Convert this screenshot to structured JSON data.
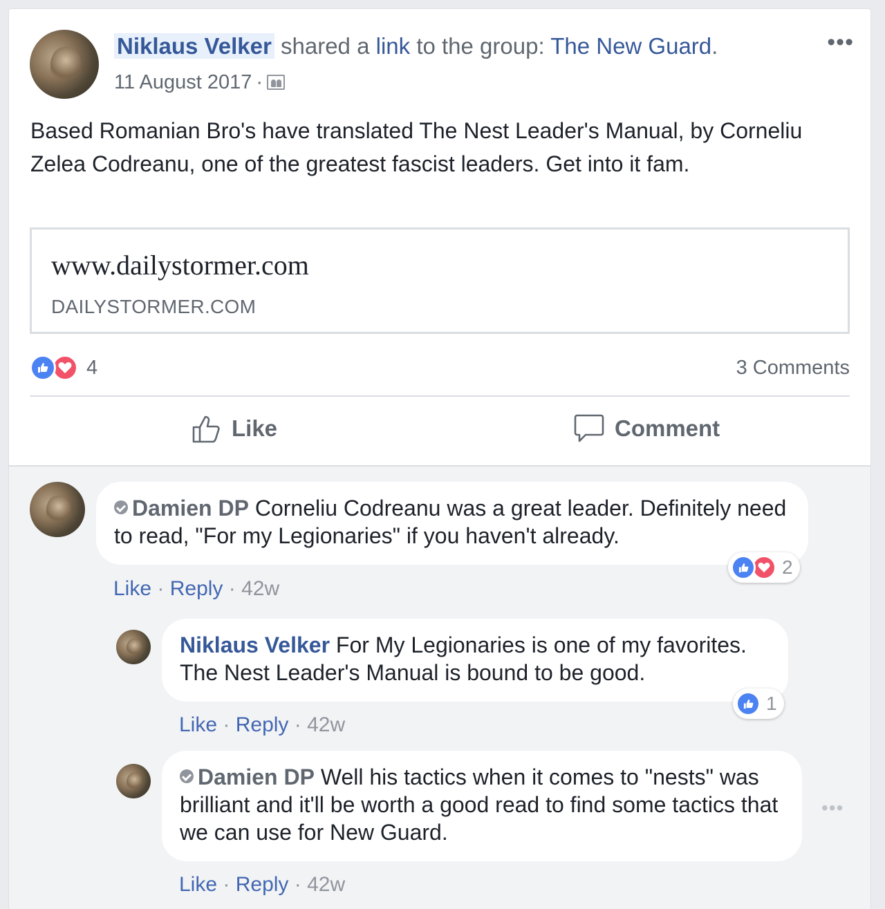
{
  "post": {
    "author": "Niklaus Velker",
    "shared_text": "shared a",
    "link_word": "link",
    "to_group_text": "to the group:",
    "group_name": "The New Guard",
    "period": ".",
    "date": "11 August 2017",
    "date_separator": "·",
    "more_icon": "•••",
    "body": "Based Romanian Bro's have translated The Nest Leader's Manual, by Corneliu Zelea Codreanu, one of the greatest fascist leaders. Get into it fam.",
    "link_preview": {
      "title": "www.dailystormer.com",
      "domain": "DAILYSTORMER.COM"
    },
    "reaction_count": "4",
    "comments_count": "3 Comments",
    "actions": {
      "like": "Like",
      "comment": "Comment"
    }
  },
  "comments": [
    {
      "author": "Damien DP",
      "verified_badge": true,
      "text": "Corneliu Codreanu was a great leader. Definitely need to read, \"For my Legionaries\" if you haven't already.",
      "like_label": "Like",
      "reply_label": "Reply",
      "sep": "·",
      "time": "42w",
      "reactions_count": "2",
      "reactions": [
        "like",
        "love"
      ]
    },
    {
      "author": "Niklaus Velker",
      "verified_badge": false,
      "text": "For My Legionaries is one of my favorites. The Nest Leader's Manual is bound to be good.",
      "like_label": "Like",
      "reply_label": "Reply",
      "sep": "·",
      "time": "42w",
      "reactions_count": "1",
      "reactions": [
        "like"
      ]
    },
    {
      "author": "Damien DP",
      "verified_badge": true,
      "text": "Well his tactics when it comes to \"nests\" was brilliant and it'll be worth a good read to find some tactics that we can use for New Guard.",
      "like_label": "Like",
      "reply_label": "Reply",
      "sep": "·",
      "time": "42w",
      "more_icon": "•••"
    }
  ],
  "colors": {
    "link_blue": "#365899",
    "meta_blue": "#4267b2",
    "like_blue": "#4c83f2",
    "love_red": "#f25268",
    "grey_text": "#606770",
    "background": "#e9ebee",
    "comment_area": "#f2f3f5"
  }
}
